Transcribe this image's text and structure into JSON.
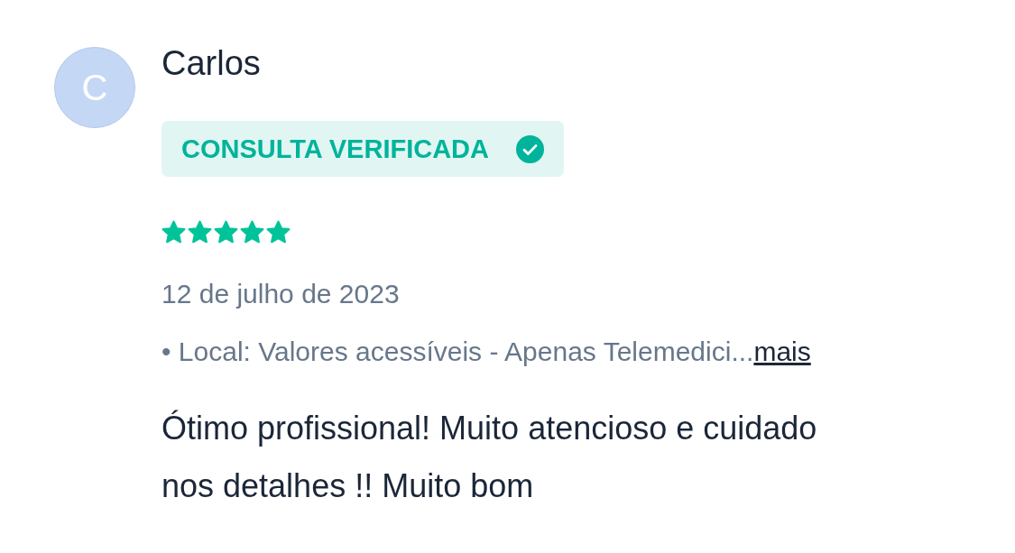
{
  "review": {
    "avatar_initial": "C",
    "author": "Carlos",
    "badge": {
      "label": "CONSULTA VERIFICADA",
      "verified": true
    },
    "stars": 5,
    "date": "12 de julho de 2023",
    "location": "• Local: Valores acessíveis - Apenas Telemedici...",
    "more_link": "mais",
    "text": "Ótimo profissional! Muito atencioso e cuidado nos detalhes !! Muito bom"
  }
}
